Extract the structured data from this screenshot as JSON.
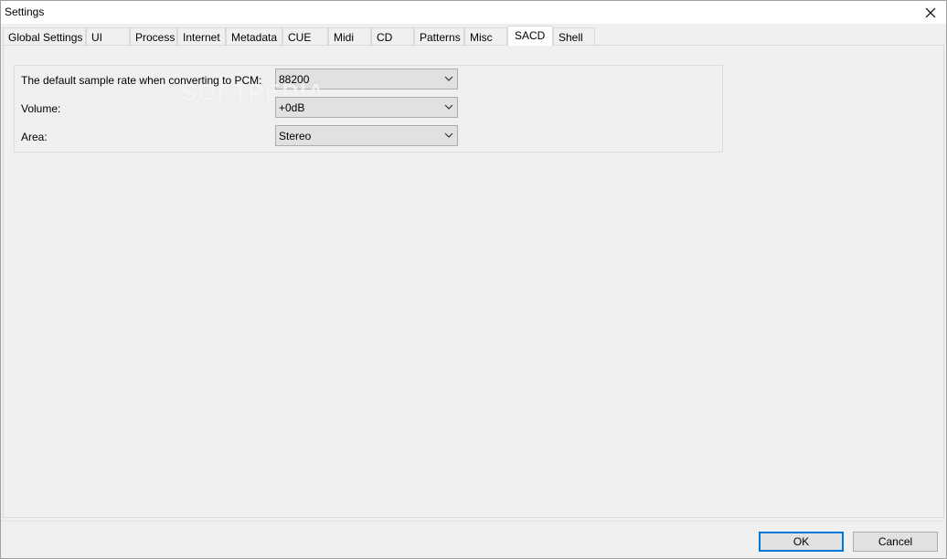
{
  "window": {
    "title": "Settings"
  },
  "tabs": [
    {
      "label": "Global Settings"
    },
    {
      "label": "UI"
    },
    {
      "label": "Process"
    },
    {
      "label": "Internet"
    },
    {
      "label": "Metadata"
    },
    {
      "label": "CUE"
    },
    {
      "label": "Midi"
    },
    {
      "label": "CD"
    },
    {
      "label": "Patterns"
    },
    {
      "label": "Misc"
    },
    {
      "label": "SACD"
    },
    {
      "label": "Shell"
    }
  ],
  "active_tab": "SACD",
  "sacd": {
    "sample_rate": {
      "label": "The default sample rate when converting to PCM:",
      "value": "88200"
    },
    "volume": {
      "label": "Volume:",
      "value": "+0dB"
    },
    "area": {
      "label": "Area:",
      "value": "Stereo"
    }
  },
  "watermark": "SOFTPEDIA",
  "buttons": {
    "ok": "OK",
    "cancel": "Cancel"
  },
  "colors": {
    "default_button_border": "#0078d7"
  }
}
